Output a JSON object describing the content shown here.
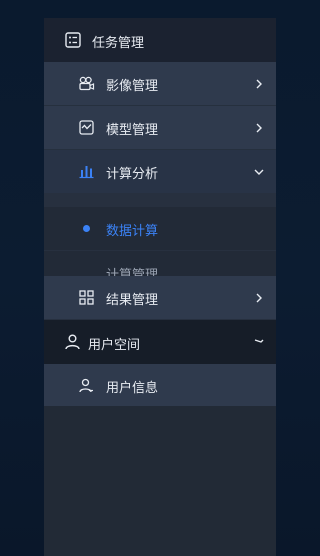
{
  "menu": {
    "header": {
      "label": "任务管理",
      "icon": "task-list-icon"
    },
    "items": [
      {
        "label": "影像管理",
        "icon": "camera-icon"
      },
      {
        "label": "模型管理",
        "icon": "model-chart-icon"
      },
      {
        "label": "计算分析",
        "icon": "bar-chart-icon",
        "expanded": true,
        "children": [
          {
            "label": "数据计算",
            "selected": true
          },
          {
            "label": "计算管理",
            "selected": false
          }
        ]
      },
      {
        "label": "结果管理",
        "icon": "grid-icon"
      }
    ],
    "user_section": {
      "label": "用户空间",
      "icon": "user-icon",
      "expanded": true,
      "children": [
        {
          "label": "用户信息",
          "icon": "user-info-icon"
        }
      ]
    }
  },
  "colors": {
    "accent": "#3b82f6",
    "panel": "#27303f",
    "background": "#0b1a2c"
  }
}
